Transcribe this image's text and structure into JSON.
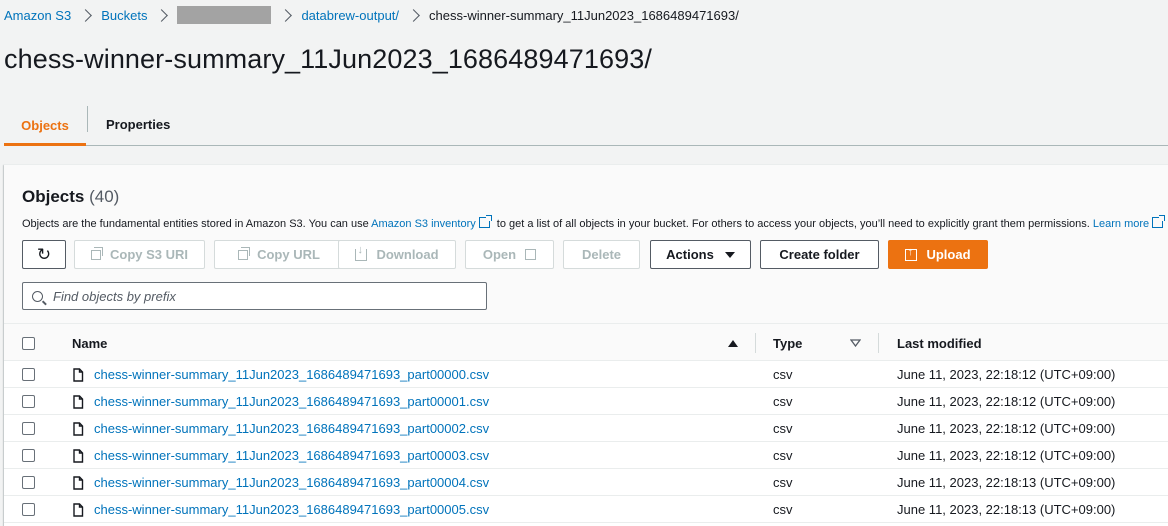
{
  "breadcrumb": {
    "items": [
      "Amazon S3",
      "Buckets",
      "databrew-output/",
      "chess-winner-summary_11Jun2023_1686489471693/"
    ]
  },
  "page": {
    "title": "chess-winner-summary_11Jun2023_1686489471693/"
  },
  "tabs": [
    "Objects",
    "Properties"
  ],
  "objects": {
    "heading": "Objects",
    "count": "(40)",
    "desc_prefix": "Objects are the fundamental entities stored in Amazon S3. You can use ",
    "desc_link": "Amazon S3 inventory",
    "desc_suffix": " to get a list of all objects in your bucket. For others to access your objects, you’ll need to explicitly grant them permissions. ",
    "learn_more": "Learn more"
  },
  "toolbar": {
    "copy_uri": "Copy S3 URI",
    "copy_url": "Copy URL",
    "download": "Download",
    "open": "Open",
    "delete": "Delete",
    "actions": "Actions",
    "create_folder": "Create folder",
    "upload": "Upload"
  },
  "search": {
    "placeholder": "Find objects by prefix"
  },
  "table": {
    "headers": {
      "name": "Name",
      "type": "Type",
      "last_modified": "Last modified"
    },
    "rows": [
      {
        "name": "chess-winner-summary_11Jun2023_1686489471693_part00000.csv",
        "type": "csv",
        "modified": "June 11, 2023, 22:18:12 (UTC+09:00)"
      },
      {
        "name": "chess-winner-summary_11Jun2023_1686489471693_part00001.csv",
        "type": "csv",
        "modified": "June 11, 2023, 22:18:12 (UTC+09:00)"
      },
      {
        "name": "chess-winner-summary_11Jun2023_1686489471693_part00002.csv",
        "type": "csv",
        "modified": "June 11, 2023, 22:18:12 (UTC+09:00)"
      },
      {
        "name": "chess-winner-summary_11Jun2023_1686489471693_part00003.csv",
        "type": "csv",
        "modified": "June 11, 2023, 22:18:12 (UTC+09:00)"
      },
      {
        "name": "chess-winner-summary_11Jun2023_1686489471693_part00004.csv",
        "type": "csv",
        "modified": "June 11, 2023, 22:18:13 (UTC+09:00)"
      },
      {
        "name": "chess-winner-summary_11Jun2023_1686489471693_part00005.csv",
        "type": "csv",
        "modified": "June 11, 2023, 22:18:13 (UTC+09:00)"
      }
    ]
  },
  "colors": {
    "link": "#0073bb",
    "accent": "#ec7211"
  }
}
